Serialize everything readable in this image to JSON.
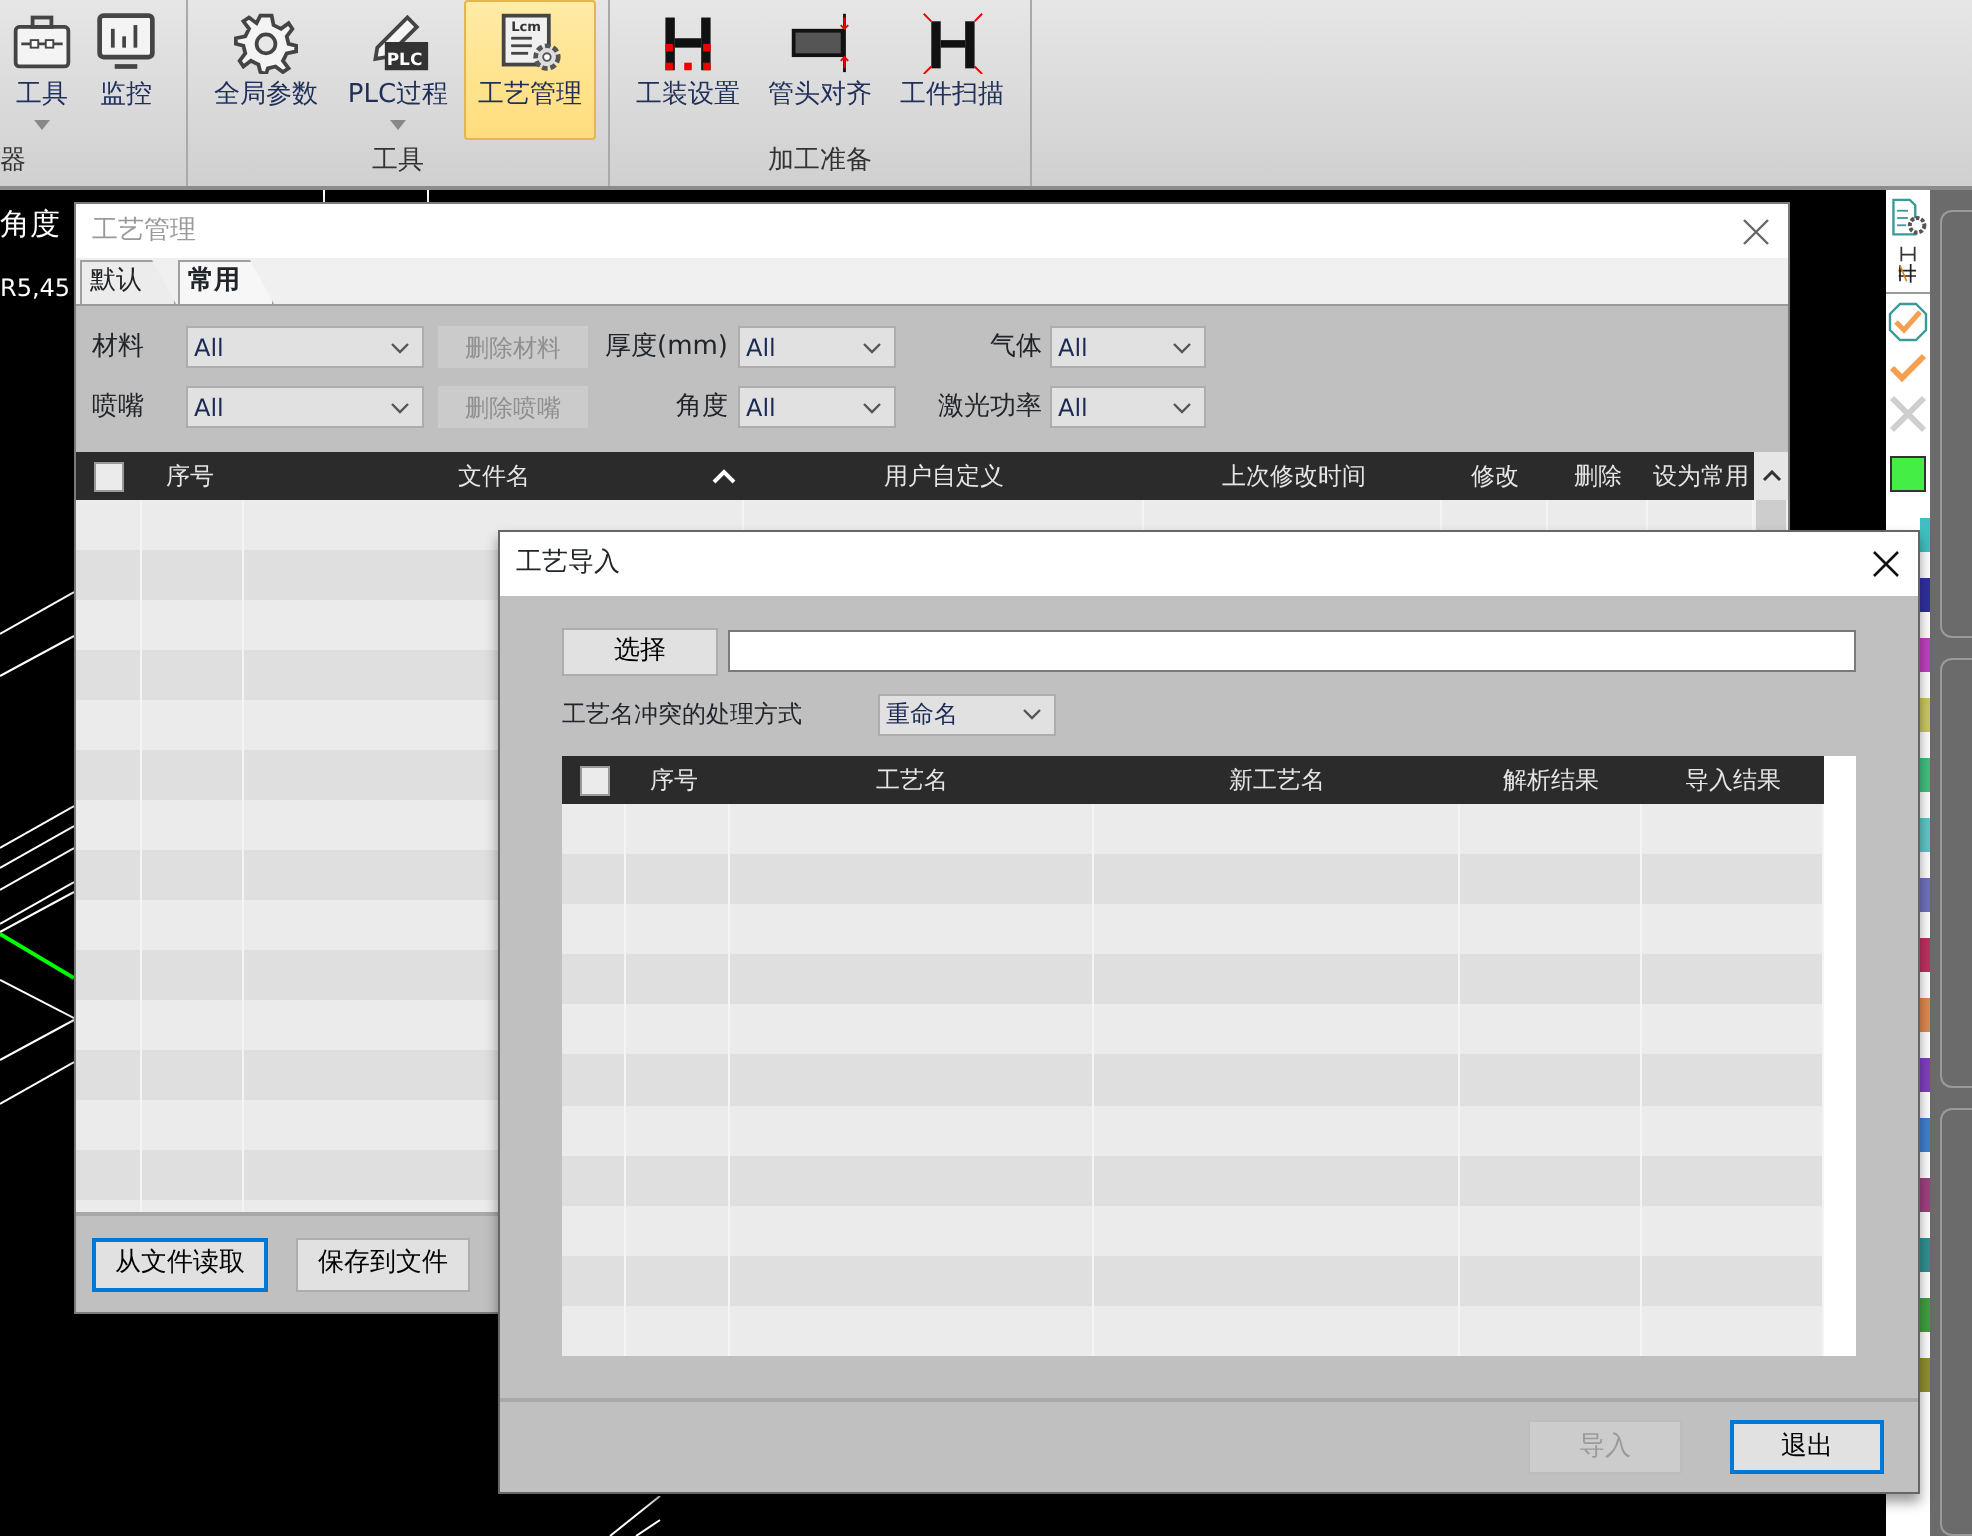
{
  "ribbon": {
    "groups": [
      {
        "label": "器",
        "buttons": [
          {
            "label": "工具",
            "dropdown": true,
            "selected": false
          },
          {
            "label": "监控",
            "dropdown": false,
            "selected": false
          }
        ]
      },
      {
        "label": "工具",
        "buttons": [
          {
            "label": "全局参数",
            "dropdown": false,
            "selected": false
          },
          {
            "label": "PLC过程",
            "icon_text": "PLC",
            "dropdown": true,
            "selected": false
          },
          {
            "label": "工艺管理",
            "icon_text": "Lcm",
            "dropdown": false,
            "selected": true
          }
        ]
      },
      {
        "label": "加工准备",
        "buttons": [
          {
            "label": "工装设置",
            "dropdown": false,
            "selected": false
          },
          {
            "label": "管头对齐",
            "dropdown": false,
            "selected": false
          },
          {
            "label": "工件扫描",
            "dropdown": false,
            "selected": false
          }
        ]
      }
    ]
  },
  "canvas": {
    "texts": [
      "角度",
      "R5,45"
    ]
  },
  "side_toolbar": {
    "swatches": [
      {
        "kind": "square",
        "color": "#44ee44"
      },
      {
        "kind": "strip",
        "color": "#40c0c0"
      },
      {
        "kind": "strip",
        "color": "#3030a0"
      },
      {
        "kind": "strip",
        "color": "#c040c0"
      },
      {
        "kind": "strip",
        "color": "#c8c860"
      },
      {
        "kind": "strip",
        "color": "#40c080"
      },
      {
        "kind": "strip",
        "color": "#60c8c8"
      },
      {
        "kind": "strip",
        "color": "#7070c0"
      },
      {
        "kind": "strip",
        "color": "#c03060"
      },
      {
        "kind": "strip",
        "color": "#e08850"
      },
      {
        "kind": "strip",
        "color": "#8040c0"
      },
      {
        "kind": "strip",
        "color": "#4080d0"
      },
      {
        "kind": "strip",
        "color": "#a04080"
      },
      {
        "kind": "strip",
        "color": "#309090"
      },
      {
        "kind": "strip",
        "color": "#40a040"
      },
      {
        "kind": "strip",
        "color": "#909030"
      }
    ]
  },
  "process_window": {
    "title": "工艺管理",
    "active": false,
    "tabs": [
      {
        "label": "默认",
        "selected": false
      },
      {
        "label": "常用",
        "selected": true
      }
    ],
    "filter_rows": [
      {
        "first": {
          "label": "材料",
          "value": "All"
        },
        "action": {
          "label": "删除材料",
          "disabled": true
        },
        "second": {
          "label": "厚度(mm)",
          "value": "All"
        },
        "third": {
          "label": "气体",
          "value": "All"
        }
      },
      {
        "first": {
          "label": "喷嘴",
          "value": "All"
        },
        "action": {
          "label": "删除喷嘴",
          "disabled": true
        },
        "second": {
          "label": "角度",
          "value": "All"
        },
        "third": {
          "label": "激光功率",
          "value": "All"
        }
      }
    ],
    "table": {
      "select_all_checked": false,
      "columns": [
        {
          "label": "序号",
          "sorted": false
        },
        {
          "label": "文件名",
          "sorted": true
        },
        {
          "label": "用户自定义",
          "sorted": false
        },
        {
          "label": "上次修改时间",
          "sorted": false
        },
        {
          "label": "修改",
          "sorted": false
        },
        {
          "label": "删除",
          "sorted": false
        },
        {
          "label": "设为常用",
          "sorted": false
        }
      ]
    },
    "buttons": [
      {
        "label": "从文件读取",
        "focused": true
      },
      {
        "label": "保存到文件",
        "focused": false
      }
    ]
  },
  "import_window": {
    "title": "工艺导入",
    "active": true,
    "choose_button": "选择",
    "conflict_label": "工艺名冲突的处理方式",
    "conflict_mode": "重命名",
    "table": {
      "select_all_checked": false,
      "columns": [
        {
          "label": "序号"
        },
        {
          "label": "工艺名"
        },
        {
          "label": "新工艺名"
        },
        {
          "label": "解析结果"
        },
        {
          "label": "导入结果"
        }
      ]
    },
    "buttons": [
      {
        "label": "导入",
        "disabled": true,
        "focused": false
      },
      {
        "label": "退出",
        "disabled": false,
        "focused": true
      }
    ]
  }
}
